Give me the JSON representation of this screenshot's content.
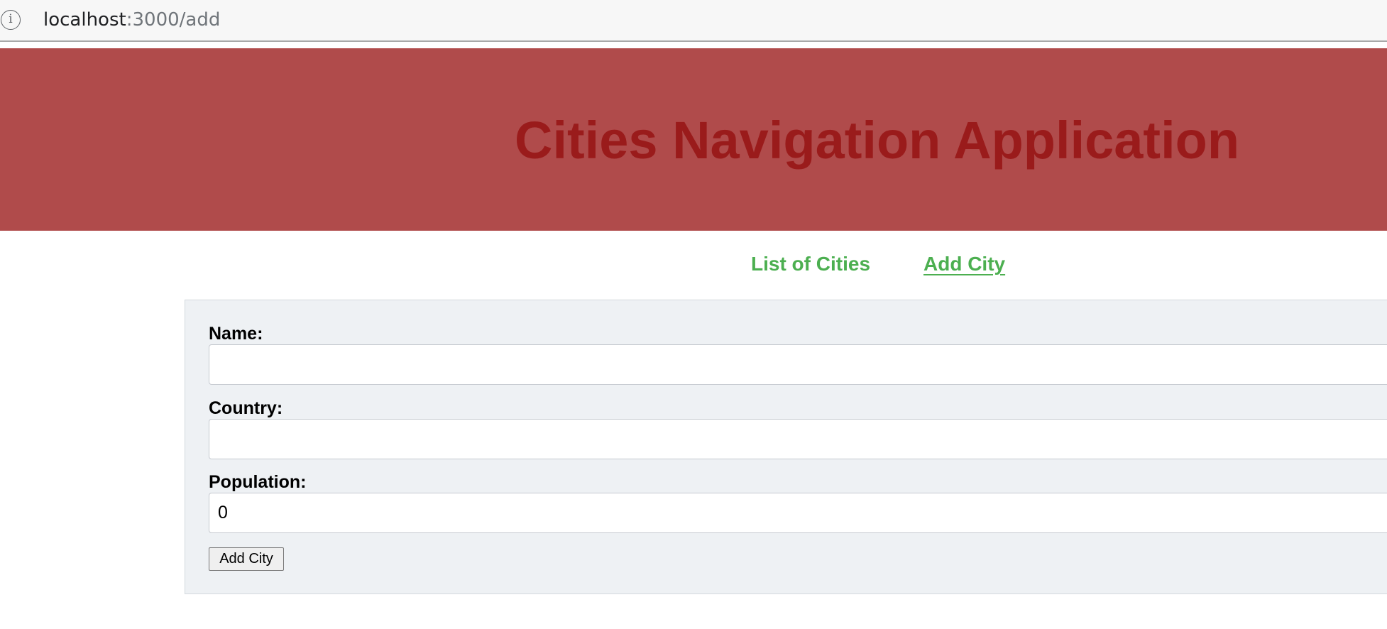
{
  "browser": {
    "url_host": "localhost",
    "url_path": ":3000/add",
    "info_icon": "info-icon",
    "info_glyph": "i"
  },
  "header": {
    "title": "Cities Navigation Application",
    "background_color": "#b04b4b",
    "title_color": "#9a1b1b"
  },
  "nav": {
    "items": [
      {
        "label": "List of Cities",
        "active": false
      },
      {
        "label": "Add City",
        "active": true
      }
    ],
    "link_color": "#4caf50"
  },
  "form": {
    "fields": [
      {
        "label": "Name:",
        "value": "",
        "placeholder": ""
      },
      {
        "label": "Country:",
        "value": "",
        "placeholder": ""
      },
      {
        "label": "Population:",
        "value": "0",
        "placeholder": ""
      }
    ],
    "submit_label": "Add City",
    "panel_color": "#eef1f4"
  }
}
